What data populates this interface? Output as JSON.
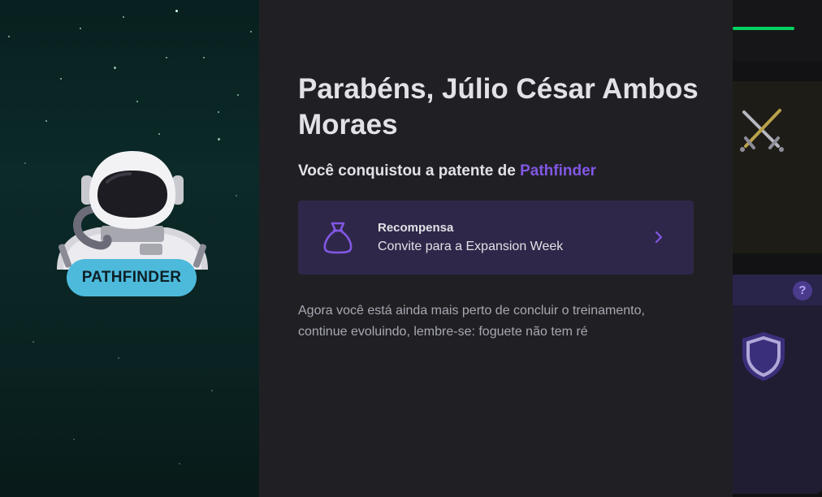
{
  "celebration": {
    "title": "Parabéns, Júlio César Ambos Moraes",
    "subtitle_prefix": "Você conquistou a patente de",
    "rank_name": "Pathfinder",
    "badge_label": "PATHFINDER",
    "reward": {
      "label": "Recompensa",
      "value": "Convite para a Expansion Week",
      "icon": "money-bag-icon"
    },
    "message": "Agora você está ainda mais perto de concluir o treinamento, continue evoluindo, lembre-se: foguete não tem ré"
  },
  "background_app": {
    "help_label": "?",
    "icons": [
      "crossed-swords-icon",
      "shield-icon"
    ]
  },
  "colors": {
    "accent": "#8257e5",
    "badge": "#4dbadb",
    "progress": "#04d361",
    "modal_bg": "#202024"
  }
}
